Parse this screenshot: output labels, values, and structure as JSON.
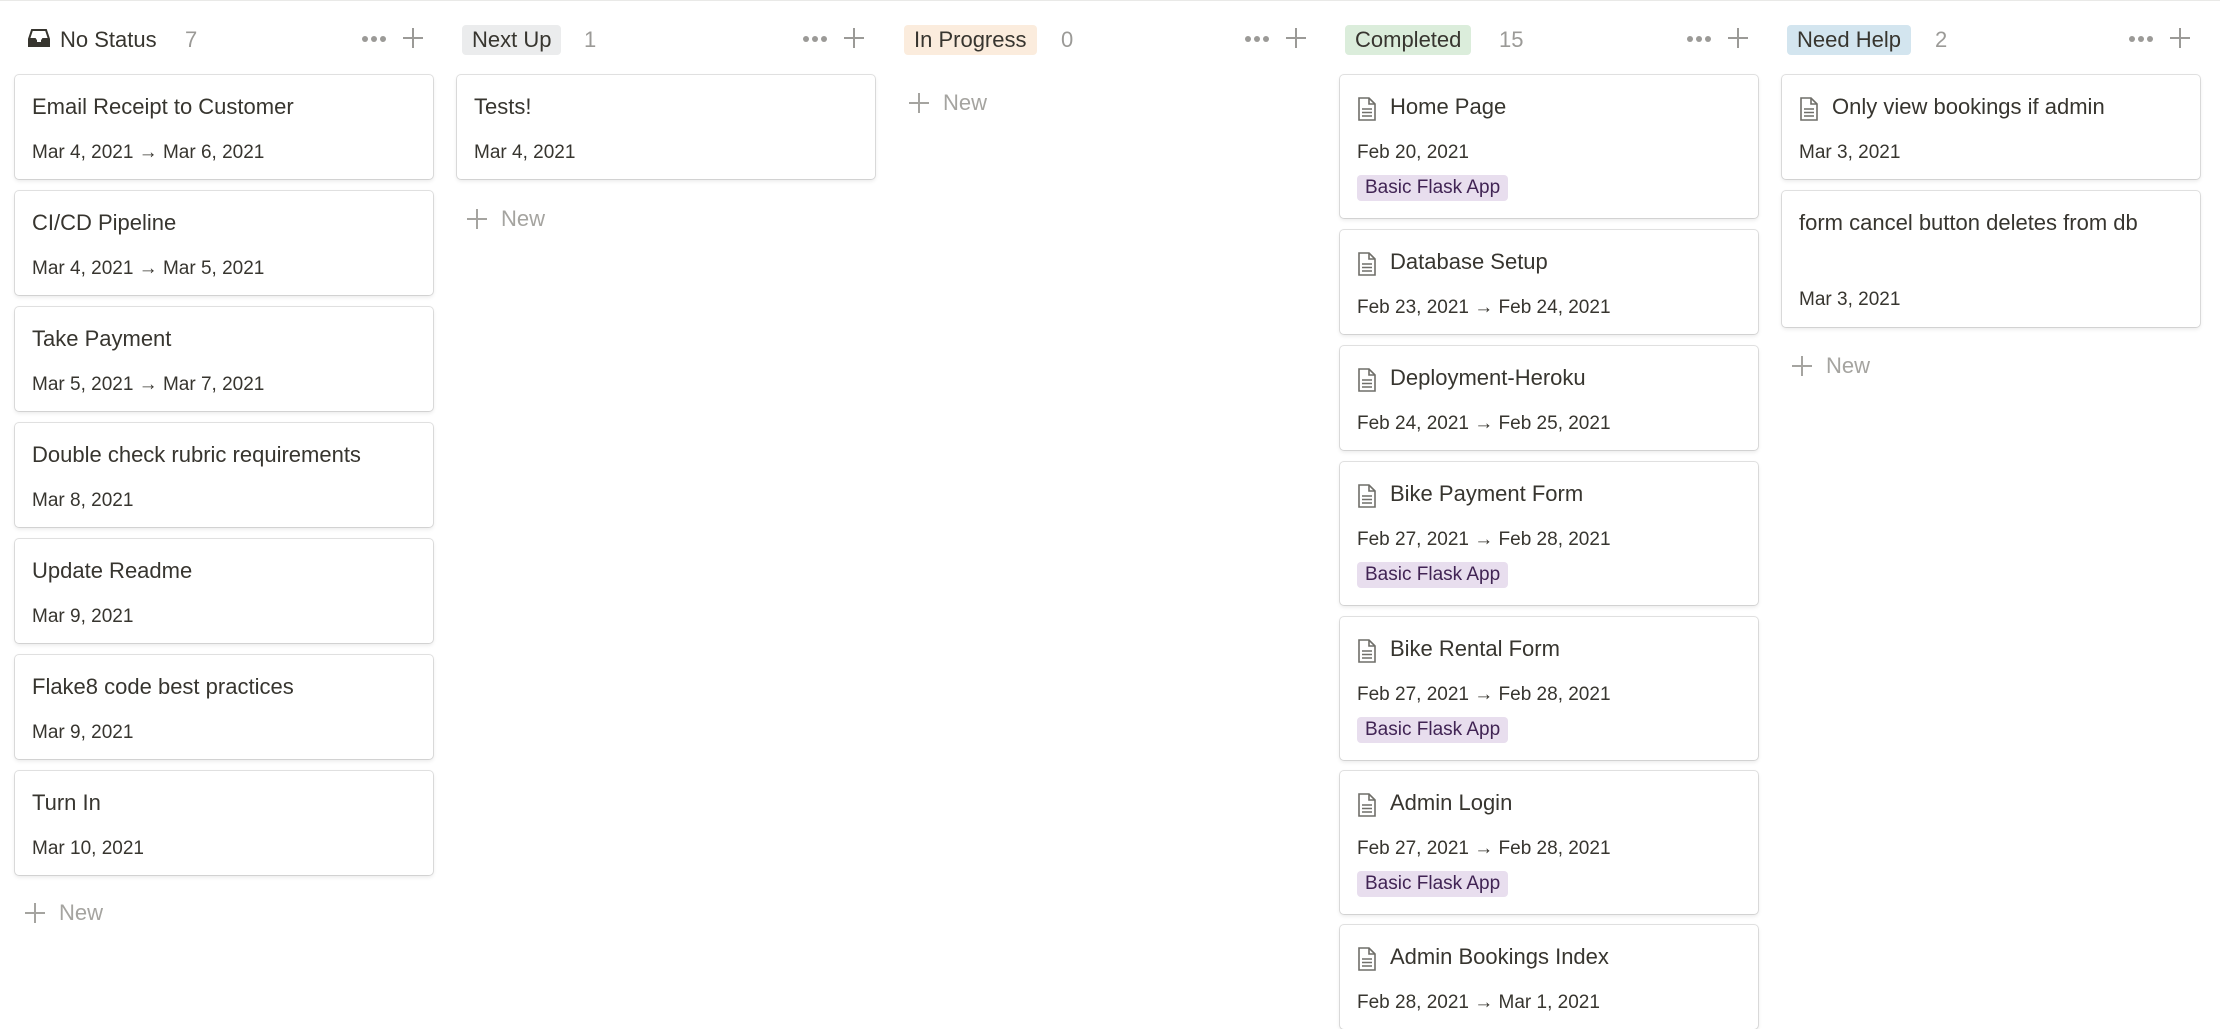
{
  "new_label": "New",
  "columns": [
    {
      "label": "No Status",
      "count": "7",
      "icon": "inbox-icon",
      "cards": [
        {
          "title": "Email Receipt to Customer",
          "date": "Mar 4, 2021 → Mar 6, 2021"
        },
        {
          "title": "CI/CD Pipeline",
          "date": "Mar 4, 2021 → Mar 5, 2021"
        },
        {
          "title": "Take Payment",
          "date": "Mar 5, 2021 → Mar 7, 2021"
        },
        {
          "title": "Double check rubric requirements",
          "date": "Mar 8, 2021"
        },
        {
          "title": "Update Readme",
          "date": "Mar 9, 2021"
        },
        {
          "title": "Flake8 code best practices",
          "date": "Mar 9, 2021"
        },
        {
          "title": "Turn In",
          "date": "Mar 10, 2021"
        }
      ]
    },
    {
      "label": "Next Up",
      "count": "1",
      "color": "#ebeced",
      "cards": [
        {
          "title": "Tests!",
          "date": "Mar 4, 2021"
        }
      ]
    },
    {
      "label": "In Progress",
      "count": "0",
      "color": "#fbecdd",
      "cards": []
    },
    {
      "label": "Completed",
      "count": "15",
      "color": "#dbeddb",
      "cards": [
        {
          "title": "Home Page",
          "date": "Feb 20, 2021",
          "tag": "Basic Flask App",
          "icon": "page-icon"
        },
        {
          "title": "Database Setup",
          "date": "Feb 23, 2021 → Feb 24, 2021",
          "icon": "page-icon"
        },
        {
          "title": "Deployment-Heroku",
          "date": "Feb 24, 2021 → Feb 25, 2021",
          "icon": "page-icon"
        },
        {
          "title": "Bike Payment Form",
          "date": "Feb 27, 2021 → Feb 28, 2021",
          "tag": "Basic Flask App",
          "icon": "page-icon"
        },
        {
          "title": "Bike Rental Form",
          "date": "Feb 27, 2021 → Feb 28, 2021",
          "tag": "Basic Flask App",
          "icon": "page-icon"
        },
        {
          "title": "Admin Login",
          "date": "Feb 27, 2021 → Feb 28, 2021",
          "tag": "Basic Flask App",
          "icon": "page-icon"
        },
        {
          "title": "Admin Bookings Index",
          "date": "Feb 28, 2021 → Mar 1, 2021",
          "icon": "page-icon"
        }
      ]
    },
    {
      "label": "Need Help",
      "count": "2",
      "color": "#d3e5ef",
      "cards": [
        {
          "title": "Only view bookings if admin",
          "date": "Mar 3, 2021",
          "icon": "page-icon"
        },
        {
          "title": "form cancel button deletes from db",
          "date": "Mar 3, 2021"
        }
      ]
    }
  ],
  "colors": {
    "text": "#37352f",
    "muted": "#9b9a97",
    "tag_background": "#e8deee",
    "tag_text": "#412454"
  }
}
